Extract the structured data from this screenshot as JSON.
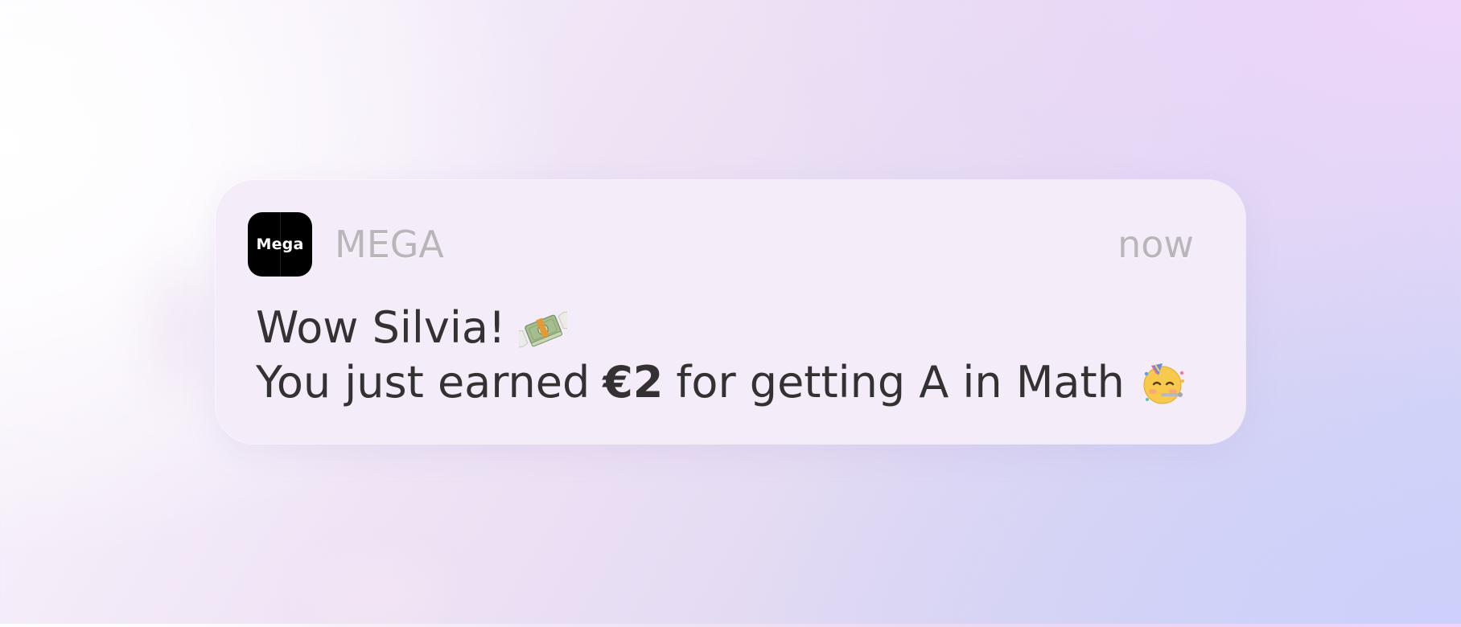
{
  "notification": {
    "app_icon_text": "Mega",
    "app_name": "MEGA",
    "timestamp": "now",
    "message": {
      "line1": "Wow Silvia!",
      "line2_before": "You just earned",
      "line2_amount": "€2",
      "line2_after": "for getting A in Math",
      "line1_emoji": "money-with-wings-icon",
      "line2_emoji": "partying-face-icon"
    }
  },
  "colors": {
    "card_background": "#f4ecf8",
    "secondary_text": "#bab5ba",
    "message_text": "#343132",
    "app_icon_background": "#000000"
  }
}
